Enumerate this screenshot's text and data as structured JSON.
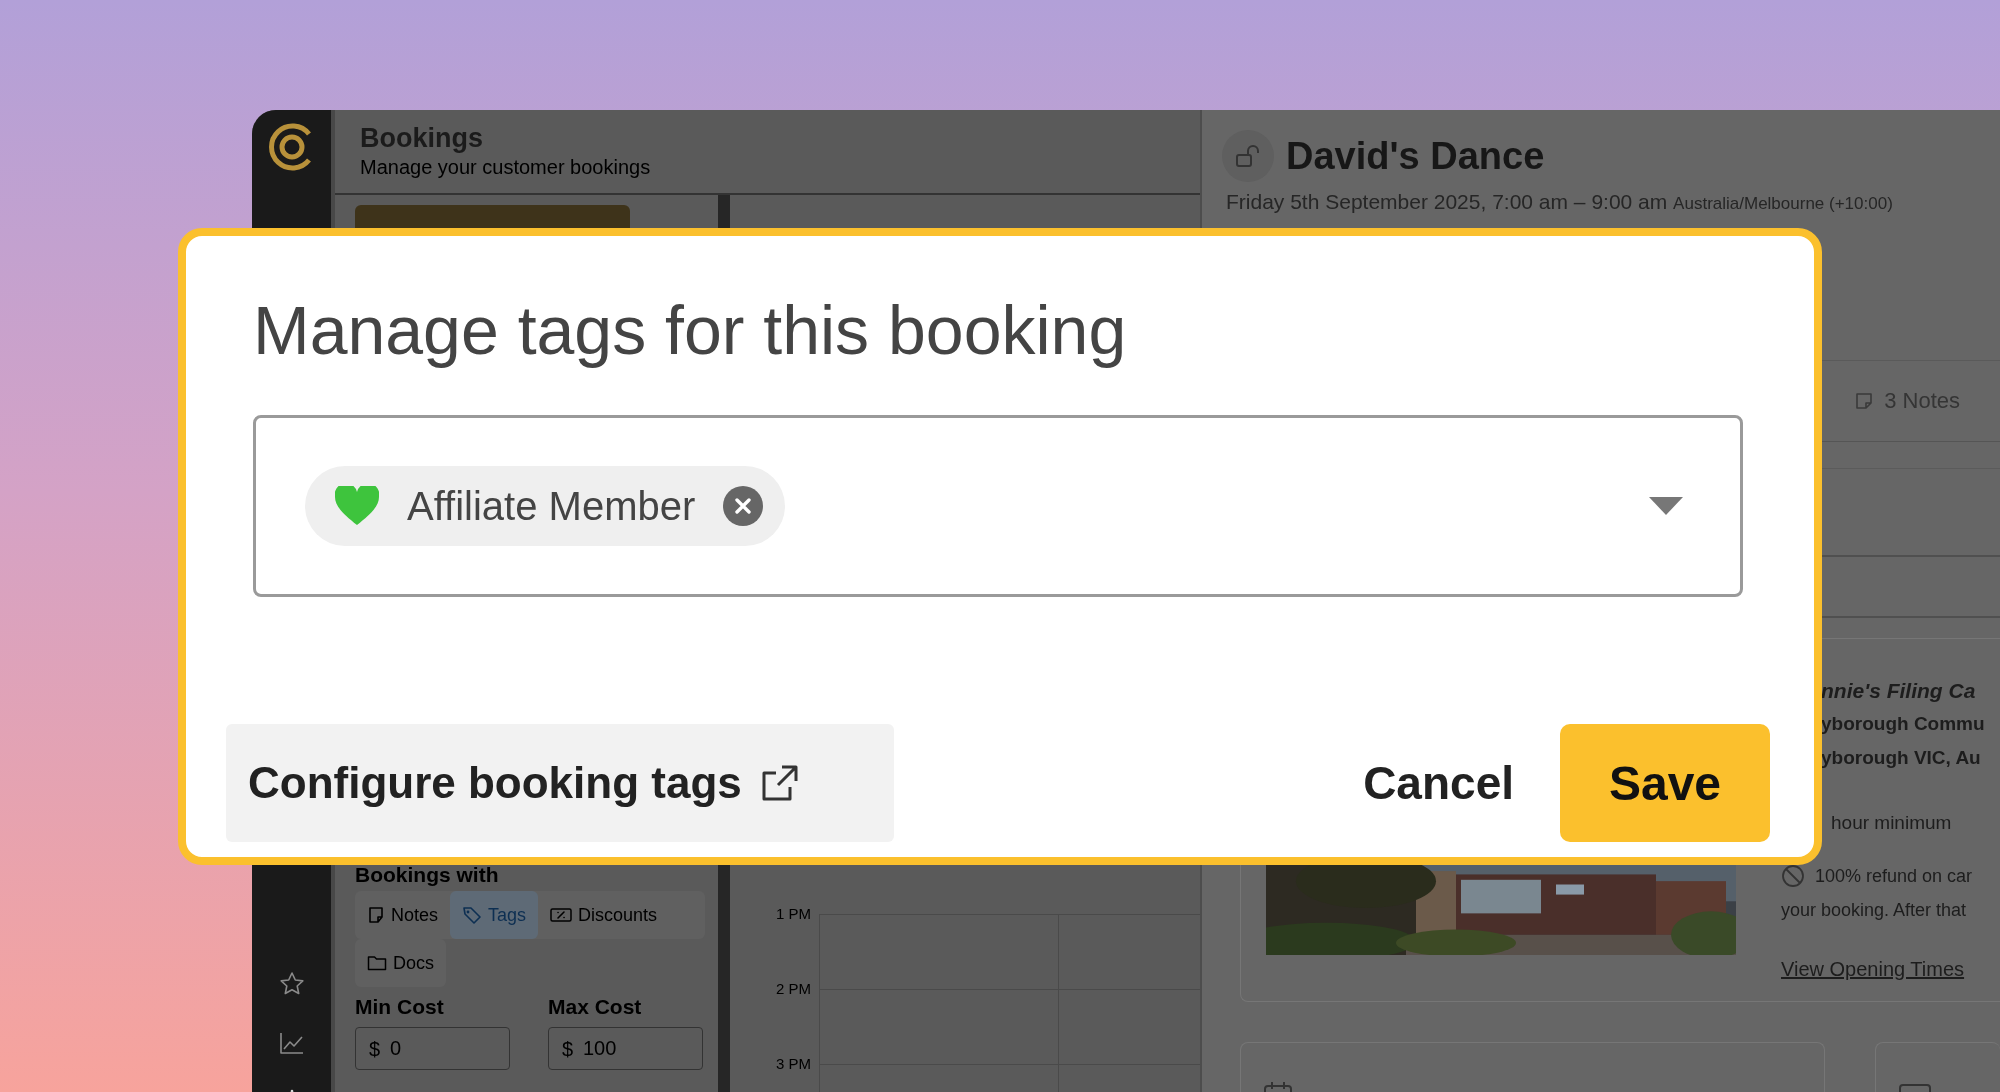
{
  "app": {
    "title": "Bookings",
    "subtitle": "Manage your customer bookings"
  },
  "filters": {
    "heading": "Bookings with",
    "options": [
      {
        "label": "Notes",
        "selected": false
      },
      {
        "label": "Tags",
        "selected": true
      },
      {
        "label": "Discounts",
        "selected": false
      },
      {
        "label": "Docs",
        "selected": false
      }
    ],
    "min_cost": {
      "label": "Min Cost",
      "prefix": "$",
      "placeholder": "0"
    },
    "max_cost": {
      "label": "Max Cost",
      "prefix": "$",
      "placeholder": "100"
    }
  },
  "calendar": {
    "times": [
      "1 PM",
      "2 PM",
      "3 PM"
    ]
  },
  "booking": {
    "title": "David's Dance",
    "date": "Friday 5th September 2025, 7:00 am – 9:00 am",
    "timezone": "Australia/Melbourne (+10:00)",
    "notes_tab": "3 Notes",
    "venue": {
      "name": "nnie's Filing Ca",
      "address_1": "yborough Commu",
      "address_2": "yborough VIC, Au"
    },
    "minimum": "hour minimum",
    "refund_1": "100% refund on car",
    "refund_2": "your booking. After that",
    "link": "View Opening Times"
  },
  "dialog": {
    "title": "Manage tags for this booking",
    "tags": [
      {
        "label": "Affiliate Member",
        "color": "#3ec43d"
      }
    ],
    "configure_button": "Configure booking tags",
    "cancel": "Cancel",
    "save": "Save"
  }
}
